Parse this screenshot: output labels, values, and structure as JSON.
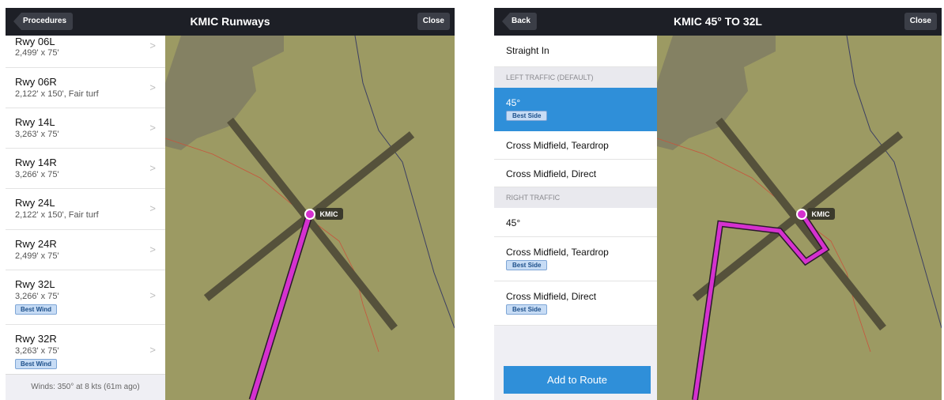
{
  "left": {
    "nav": {
      "back_label": "Procedures",
      "title": "KMIC Runways",
      "close_label": "Close"
    },
    "runways": [
      {
        "name": "Rwy 06L",
        "dims": "2,499' x 75'"
      },
      {
        "name": "Rwy 06R",
        "dims": "2,122' x 150', Fair turf"
      },
      {
        "name": "Rwy 14L",
        "dims": "3,263' x 75'"
      },
      {
        "name": "Rwy 14R",
        "dims": "3,266' x 75'"
      },
      {
        "name": "Rwy 24L",
        "dims": "2,122' x 150', Fair turf"
      },
      {
        "name": "Rwy 24R",
        "dims": "2,499' x 75'"
      },
      {
        "name": "Rwy 32L",
        "dims": "3,266' x 75'",
        "badge": "Best Wind"
      },
      {
        "name": "Rwy 32R",
        "dims": "3,263' x 75'",
        "badge": "Best Wind"
      }
    ],
    "winds": "Winds: 350° at 8 kts (61m ago)",
    "airport_label": "KMIC"
  },
  "right": {
    "nav": {
      "back_label": "Back",
      "title": "KMIC 45° TO 32L",
      "close_label": "Close"
    },
    "straight_in": "Straight In",
    "left_header": "LEFT TRAFFIC (DEFAULT)",
    "left_items": [
      {
        "label": "45°",
        "badge": "Best Side",
        "selected": true
      },
      {
        "label": "Cross Midfield, Teardrop"
      },
      {
        "label": "Cross Midfield, Direct"
      }
    ],
    "right_header": "RIGHT TRAFFIC",
    "right_items": [
      {
        "label": "45°"
      },
      {
        "label": "Cross Midfield, Teardrop",
        "badge": "Best Side"
      },
      {
        "label": "Cross Midfield, Direct",
        "badge": "Best Side"
      }
    ],
    "add_button": "Add to Route",
    "airport_label": "KMIC"
  },
  "colors": {
    "map_terrain": "#9c9a63",
    "route_magenta": "#d531cf",
    "runway": "#55513b",
    "selected_blue": "#2f8fd9"
  }
}
